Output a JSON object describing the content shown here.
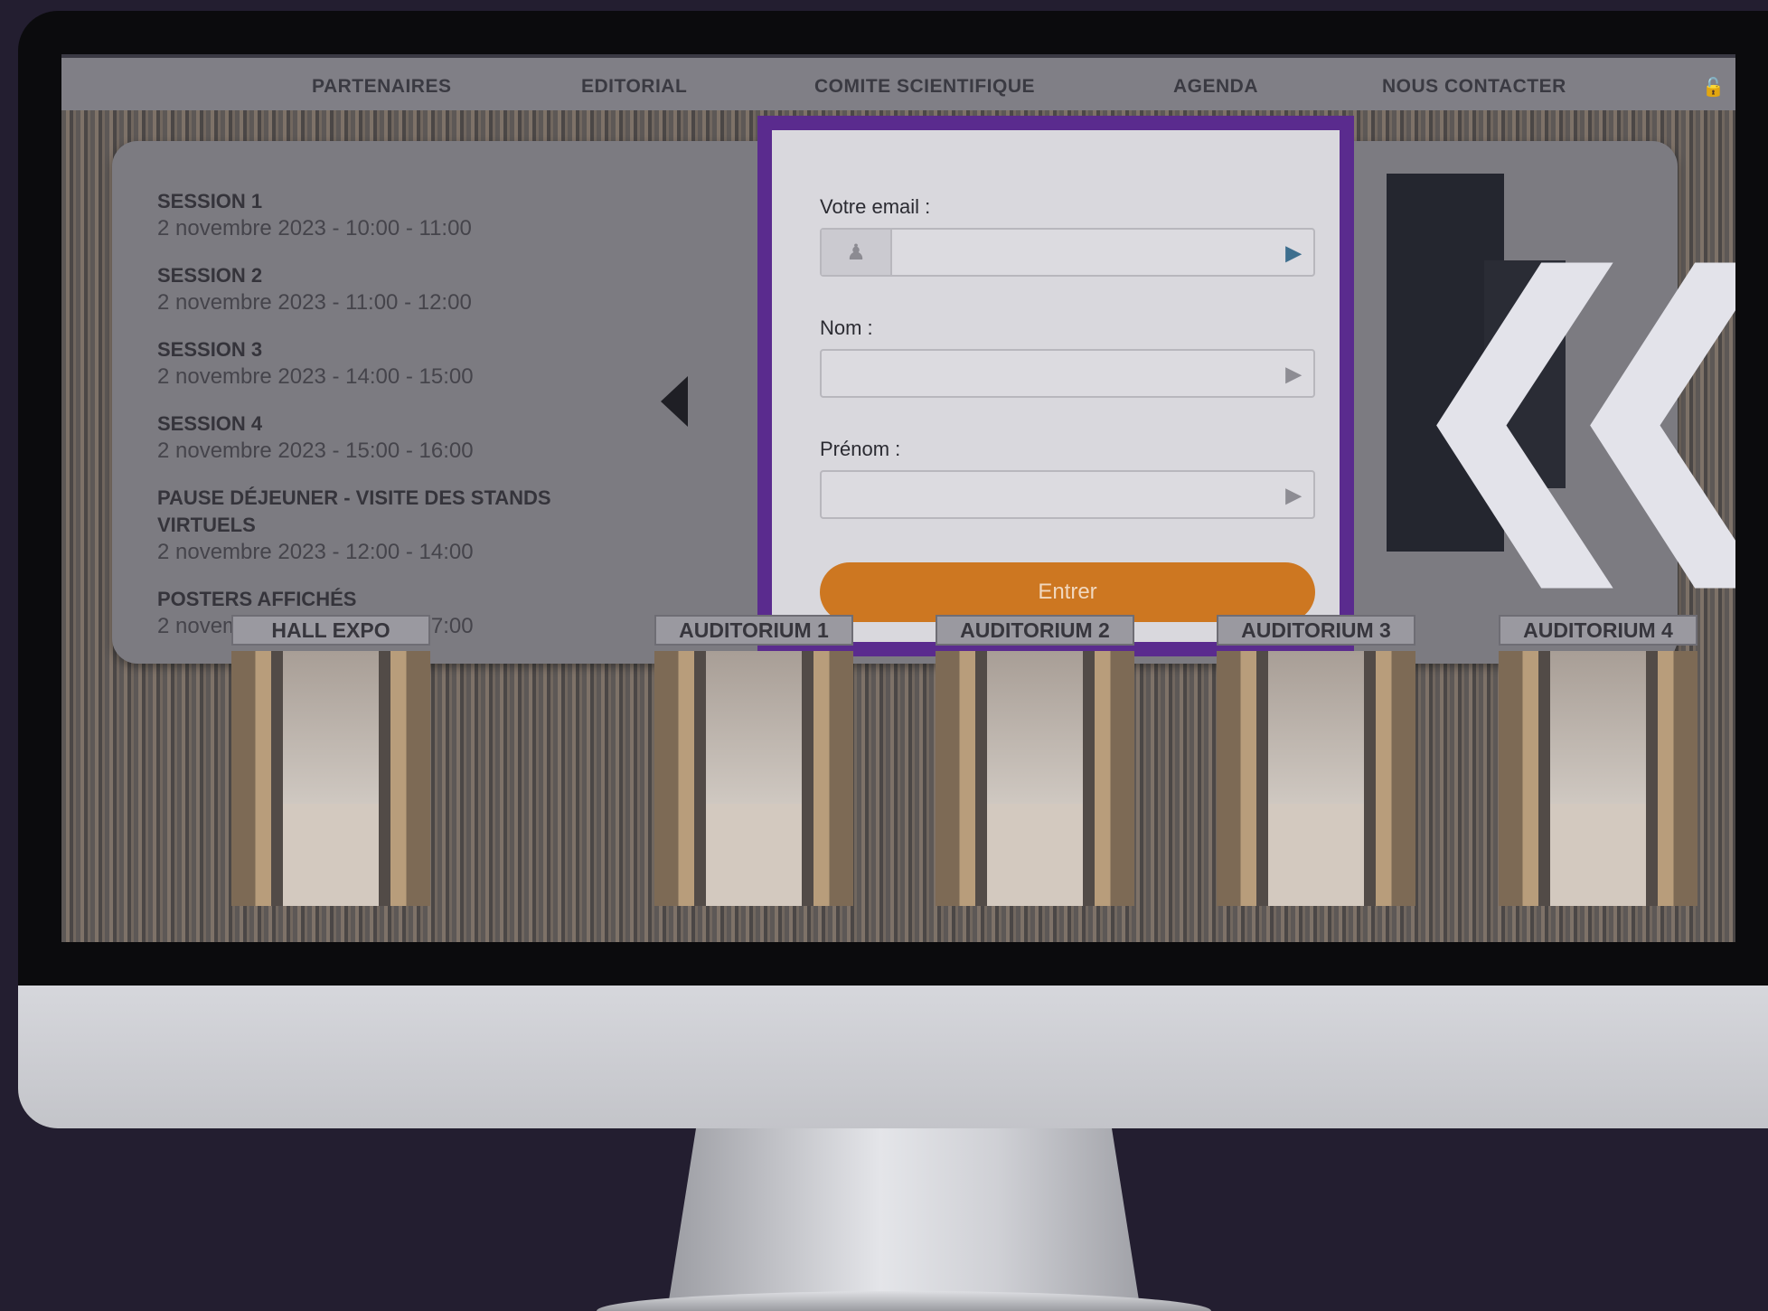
{
  "nav": {
    "items": [
      "PARTENAIRES",
      "EDITORIAL",
      "COMITE SCIENTIFIQUE",
      "AGENDA",
      "NOUS CONTACTER"
    ],
    "lock_icon": "lock-icon"
  },
  "agenda": {
    "sessions": [
      {
        "title": "SESSION 1",
        "time": "2 novembre 2023 - 10:00 - 11:00"
      },
      {
        "title": "SESSION 2",
        "time": "2 novembre 2023 - 11:00 - 12:00"
      },
      {
        "title": "SESSION 3",
        "time": "2 novembre 2023 - 14:00 - 15:00"
      },
      {
        "title": "SESSION 4",
        "time": "2 novembre 2023 - 15:00 - 16:00"
      },
      {
        "title": "PAUSE DÉJEUNER - VISITE DES STANDS VIRTUELS",
        "time": "2 novembre 2023 - 12:00 - 14:00"
      },
      {
        "title": "POSTERS AFFICHÉS",
        "time": "2 novembre 2023 - 10:00 - 17:00"
      }
    ]
  },
  "login": {
    "email_label": "Votre email :",
    "nom_label": "Nom :",
    "prenom_label": "Prénom :",
    "email_value": "",
    "nom_value": "",
    "prenom_value": "",
    "submit_label": "Entrer",
    "accent_color": "#5a2b8e",
    "button_color": "#cd7721"
  },
  "rooms": [
    "HALL EXPO",
    "AUDITORIUM 1",
    "AUDITORIUM 2",
    "AUDITORIUM 3",
    "AUDITORIUM 4"
  ]
}
